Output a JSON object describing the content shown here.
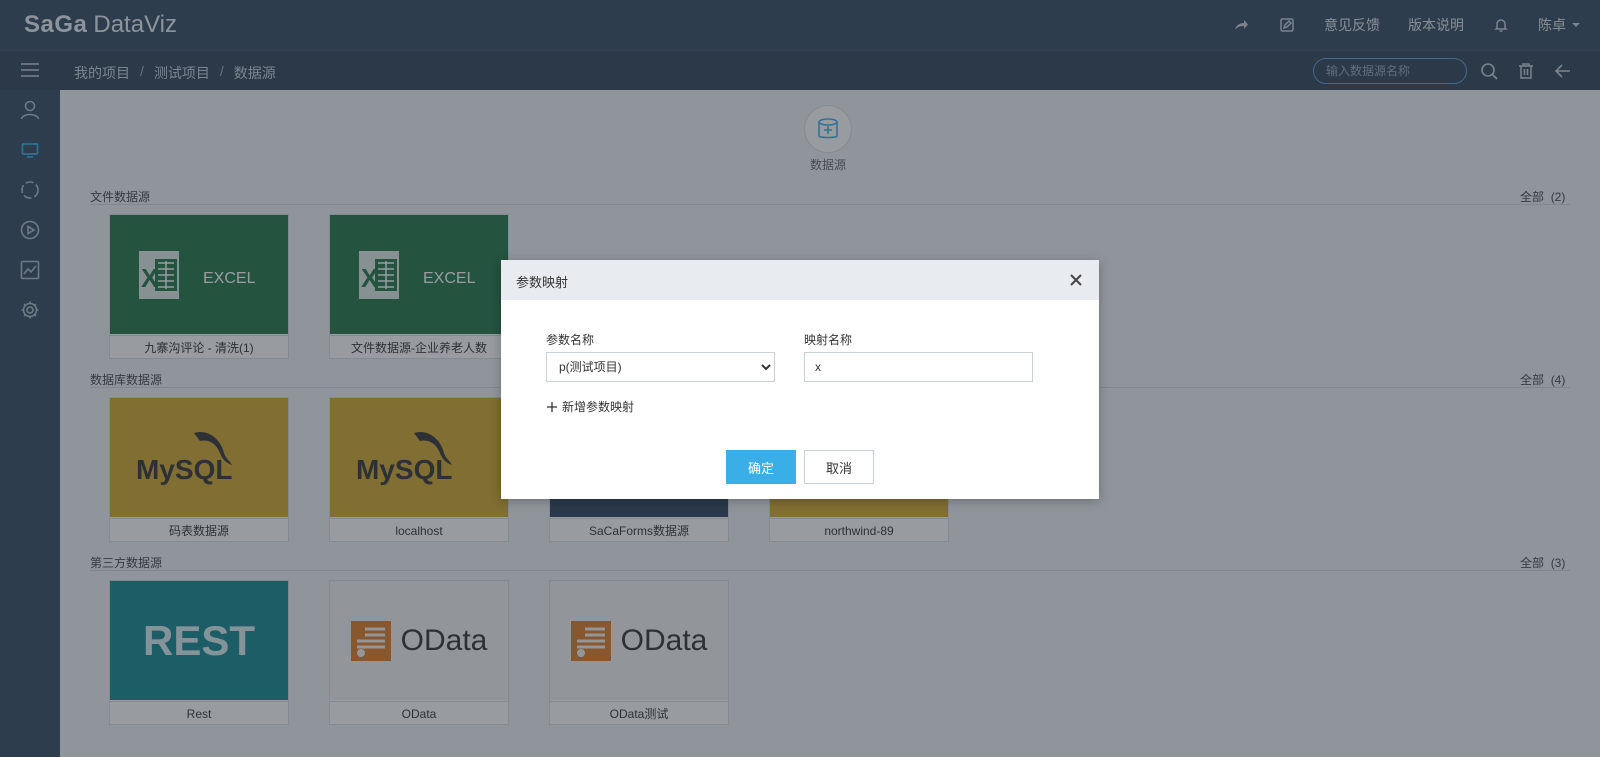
{
  "app": {
    "logo_saga": "SaGa",
    "logo_dataviz": "DataViz"
  },
  "topbar": {
    "feedback": "意见反馈",
    "release_notes": "版本说明",
    "user": "陈卓"
  },
  "breadcrumb": [
    "我的项目",
    "测试项目",
    "数据源"
  ],
  "search": {
    "placeholder": "输入数据源名称"
  },
  "add_datasource": {
    "label": "数据源"
  },
  "sections": {
    "file": {
      "title": "文件数据源",
      "all": "全部",
      "count": "(2)"
    },
    "db": {
      "title": "数据库数据源",
      "all": "全部",
      "count": "(4)"
    },
    "third": {
      "title": "第三方数据源",
      "all": "全部",
      "count": "(3)"
    }
  },
  "cards": {
    "file": [
      {
        "name": "九寨沟评论 - 清洗(1)",
        "logo": "EXCEL"
      },
      {
        "name": "文件数据源-企业养老人数",
        "logo": "EXCEL"
      }
    ],
    "db": [
      {
        "name": "码表数据源",
        "logo": "MySQL"
      },
      {
        "name": "localhost",
        "logo": "MySQL"
      },
      {
        "name": "SaCaForms数据源",
        "logo": ""
      },
      {
        "name": "northwind-89",
        "logo": ""
      }
    ],
    "third": [
      {
        "name": "Rest",
        "logo": "REST"
      },
      {
        "name": "OData",
        "logo": "OData"
      },
      {
        "name": "OData测试",
        "logo": "OData"
      }
    ]
  },
  "dialog": {
    "title": "参数映射",
    "param_label": "参数名称",
    "param_value": "p(测试项目)",
    "map_label": "映射名称",
    "map_value": "x",
    "add_mapping": "新增参数映射",
    "ok": "确定",
    "cancel": "取消"
  },
  "colors": {
    "topbar": "#34495e",
    "excel": "#217346",
    "mysql": "#d4a72c",
    "rest": "#13868f",
    "odata": "#e07b24",
    "primary": "#3aaee6"
  }
}
